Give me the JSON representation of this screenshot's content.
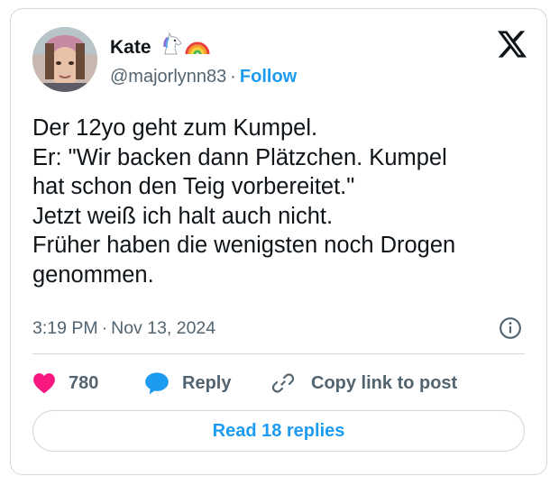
{
  "author": {
    "display_name": "Kate",
    "handle": "@majorlynn83",
    "follow_label": "Follow",
    "name_emojis": [
      "unicorn-emoji",
      "rainbow-emoji"
    ]
  },
  "separator": "·",
  "tweet": {
    "lines": [
      "Der 12yo geht zum Kumpel.",
      "Er: \"Wir backen dann Plätzchen. Kumpel",
      "hat schon den Teig vorbereitet.\"",
      "Jetzt weiß ich halt auch nicht.",
      "Früher haben die wenigsten noch Drogen",
      "genommen."
    ],
    "time": "3:19 PM",
    "date": "Nov 13, 2024"
  },
  "actions": {
    "like_count": "780",
    "reply_label": "Reply",
    "copy_link_label": "Copy link to post"
  },
  "read_replies_label": "Read 18 replies",
  "colors": {
    "accent": "#1d9bf0",
    "like": "#f91880",
    "text": "#0f1419",
    "muted": "#536471",
    "border": "#cfd9de"
  },
  "icons": [
    "x-logo-icon",
    "info-icon",
    "heart-icon",
    "reply-bubble-icon",
    "link-icon"
  ]
}
